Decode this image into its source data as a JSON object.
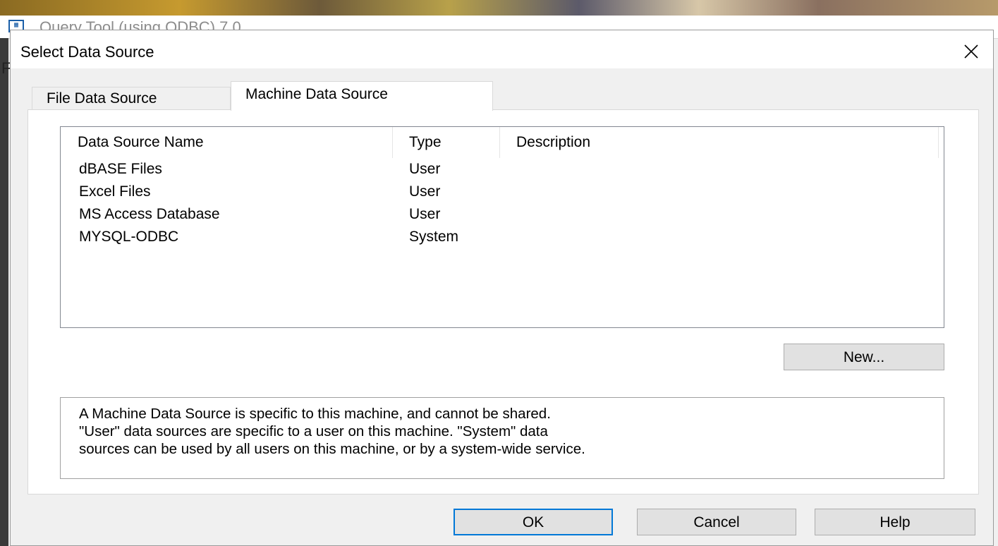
{
  "parent_window": {
    "title": "Query Tool (using ODBC) 7.0",
    "menu_letter": "F"
  },
  "dialog": {
    "title": "Select Data Source"
  },
  "tabs": [
    {
      "label": "File Data Source",
      "active": false
    },
    {
      "label": "Machine Data Source",
      "active": true
    }
  ],
  "list": {
    "columns": [
      "Data Source Name",
      "Type",
      "Description"
    ],
    "rows": [
      {
        "name": "dBASE Files",
        "type": "User",
        "description": ""
      },
      {
        "name": "Excel Files",
        "type": "User",
        "description": ""
      },
      {
        "name": "MS Access Database",
        "type": "User",
        "description": ""
      },
      {
        "name": "MYSQL-ODBC",
        "type": "System",
        "description": ""
      }
    ]
  },
  "buttons": {
    "new": "New...",
    "ok": "OK",
    "cancel": "Cancel",
    "help": "Help"
  },
  "description_lines": [
    "A Machine Data Source is specific to this machine, and cannot be shared.",
    "\"User\" data sources are specific to a user on this machine.  \"System\" data",
    "sources can be used by all users on this machine, or by a system-wide service."
  ],
  "icons": {
    "close": "close-icon",
    "app": "app-icon"
  },
  "colors": {
    "focus_border": "#0078d7",
    "dialog_bg": "#f0f0f0",
    "panel_bg": "#ffffff"
  }
}
